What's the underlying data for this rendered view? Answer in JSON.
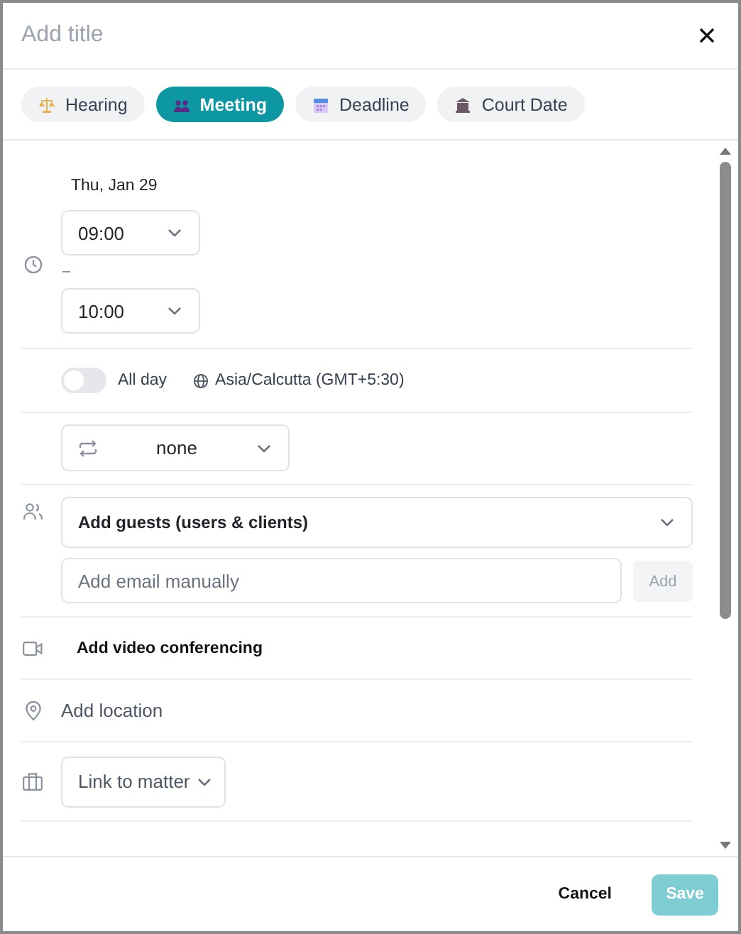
{
  "header": {
    "title_placeholder": "Add title"
  },
  "event_types": [
    {
      "label": "Hearing",
      "kind": "hearing",
      "selected": false
    },
    {
      "label": "Meeting",
      "kind": "meeting",
      "selected": true
    },
    {
      "label": "Deadline",
      "kind": "deadline",
      "selected": false
    },
    {
      "label": "Court Date",
      "kind": "court",
      "selected": false
    }
  ],
  "date": "Thu, Jan 29",
  "start_time": "09:00",
  "separator": "–",
  "end_time": "10:00",
  "all_day": {
    "label": "All day",
    "on": false
  },
  "timezone": "Asia/Calcutta (GMT+5:30)",
  "repeat": "none",
  "guests": {
    "label": "Add guests (users & clients)",
    "email_placeholder": "Add email manually",
    "add_button": {
      "label": "Add",
      "disabled": true
    }
  },
  "video": "Add video conferencing",
  "location_placeholder": "Add location",
  "matter": "Link to matter",
  "footer": {
    "cancel": "Cancel",
    "save": {
      "label": "Save",
      "disabled": true
    }
  }
}
